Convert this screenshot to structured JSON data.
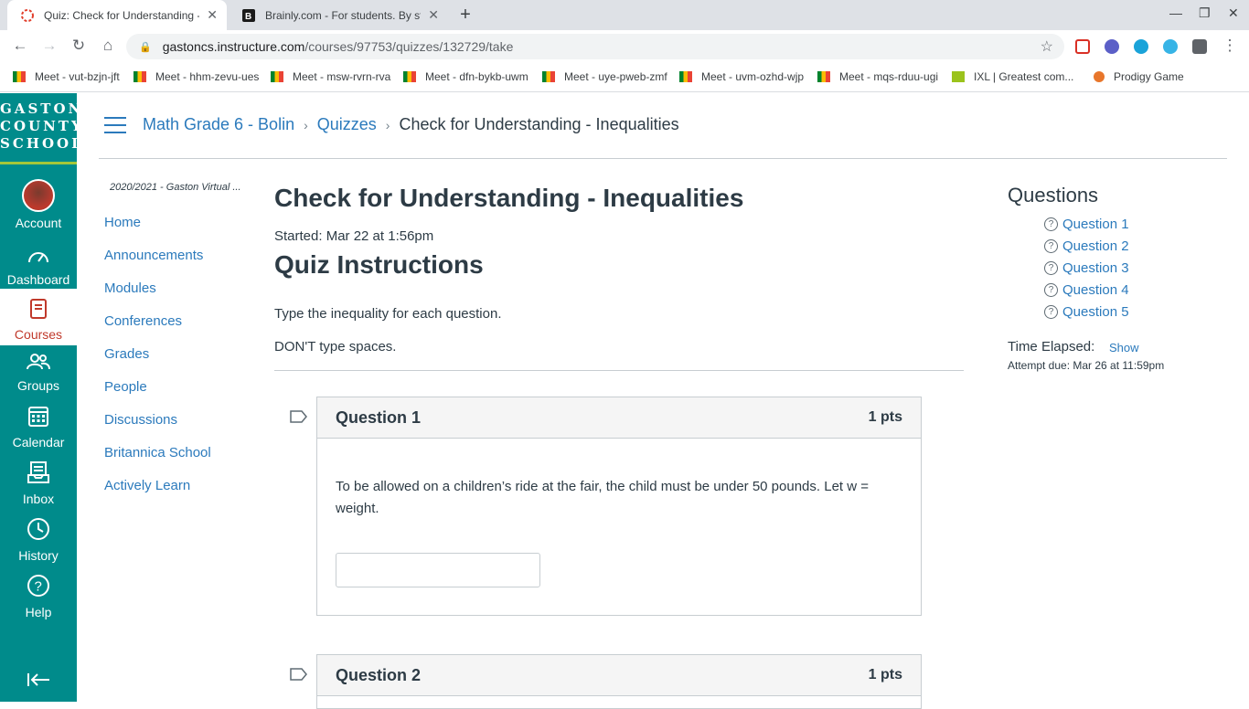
{
  "browser": {
    "tabs": [
      {
        "title": "Quiz: Check for Understanding -",
        "active": true
      },
      {
        "title": "Brainly.com - For students. By st",
        "active": false
      }
    ],
    "url": {
      "host": "gastoncs.instructure.com",
      "path": "/courses/97753/quizzes/132729/take"
    },
    "bookmarks": [
      "Meet - vut-bzjn-jft",
      "Meet - hhm-zevu-ues",
      "Meet - msw-rvrn-rva",
      "Meet - dfn-bykb-uwm",
      "Meet - uye-pweb-zmf",
      "Meet - uvm-ozhd-wjp",
      "Meet - mqs-rduu-ugi",
      "IXL | Greatest com...",
      "Prodigy Game"
    ]
  },
  "global_nav": {
    "logo": [
      "GASTON",
      "COUNTY",
      "SCHOOLS"
    ],
    "items": [
      "Account",
      "Dashboard",
      "Courses",
      "Groups",
      "Calendar",
      "Inbox",
      "History",
      "Help"
    ]
  },
  "breadcrumbs": [
    "Math Grade 6 - Bolin",
    "Quizzes",
    "Check for Understanding - Inequalities"
  ],
  "course_nav": {
    "term": "2020/2021 - Gaston Virtual ...",
    "items": [
      "Home",
      "Announcements",
      "Modules",
      "Conferences",
      "Grades",
      "People",
      "Discussions",
      "Britannica School",
      "Actively Learn"
    ]
  },
  "quiz": {
    "title": "Check for Understanding - Inequalities",
    "started": "Started: Mar 22 at 1:56pm",
    "instructions_title": "Quiz Instructions",
    "instructions": [
      "Type the inequality for each question.",
      "DON'T type spaces."
    ],
    "questions": [
      {
        "name": "Question 1",
        "points": "1 pts",
        "text": "To be allowed on a children’s ride at the fair, the child must be under 50 pounds. Let w = weight.",
        "answer": ""
      },
      {
        "name": "Question 2",
        "points": "1 pts"
      }
    ]
  },
  "sidebar": {
    "title": "Questions",
    "questions": [
      "Question 1",
      "Question 2",
      "Question 3",
      "Question 4",
      "Question 5"
    ],
    "time_elapsed_label": "Time Elapsed:",
    "show_label": "Show",
    "attempt_due": "Attempt due: Mar 26 at 11:59pm"
  },
  "colors": {
    "nav_bg": "#008b8b",
    "link": "#2b7abc",
    "active": "#c0392b"
  }
}
